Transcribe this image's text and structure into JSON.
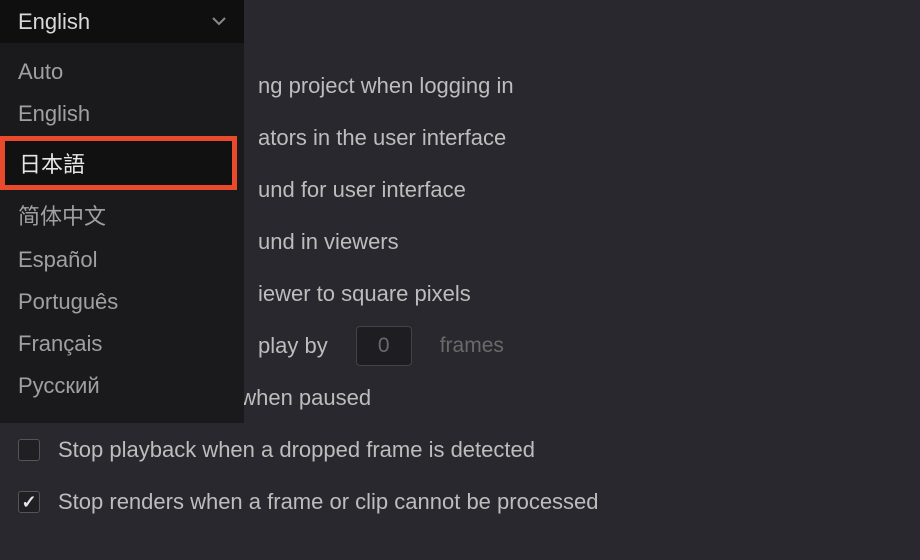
{
  "language_dropdown": {
    "selected": "English",
    "options": [
      {
        "label": "Auto"
      },
      {
        "label": "English"
      },
      {
        "label": "日本語",
        "highlighted": true
      },
      {
        "label": "简体中文"
      },
      {
        "label": "Español"
      },
      {
        "label": "Português"
      },
      {
        "label": "Français"
      },
      {
        "label": "Русский"
      }
    ]
  },
  "settings": {
    "row0": {
      "label": "ng project when logging in",
      "full_label": "Reload last working project when logging in"
    },
    "row1": {
      "label": "ators in the user interface",
      "full_label": "Show focus indicators in the user interface"
    },
    "row2": {
      "label": "und for user interface",
      "full_label": "Use gray background for user interface"
    },
    "row3": {
      "label": "und in viewers",
      "full_label": "Use gray background in viewers"
    },
    "row4": {
      "label": "iewer to square pixels",
      "full_label": "Resize image in viewer to square pixels"
    },
    "row5": {
      "label_pre": "play by",
      "full_label_pre": "Delay viewer display by",
      "value": "0",
      "label_post": "frames"
    },
    "row6": {
      "label": "Output single field when paused"
    },
    "row7": {
      "label": "Stop playback when a dropped frame is detected"
    },
    "row8": {
      "label": "Stop renders when a frame or clip cannot be processed",
      "checked": true
    }
  }
}
